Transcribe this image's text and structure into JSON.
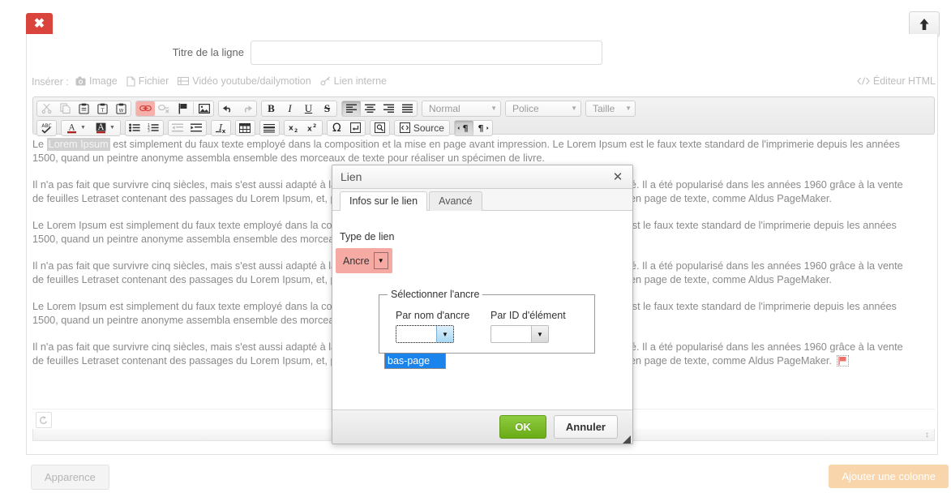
{
  "topbar": {
    "close_label": "✖",
    "scroll_top_icon": "arrow-up-icon"
  },
  "row_title": {
    "label": "Titre de la ligne",
    "value": "",
    "placeholder": ""
  },
  "insert_bar": {
    "label": "Insérer :",
    "items": [
      {
        "label": "Image",
        "icon": "camera-icon"
      },
      {
        "label": "Fichier",
        "icon": "file-icon"
      },
      {
        "label": "Vidéo youtube/dailymotion",
        "icon": "film-icon"
      },
      {
        "label": "Lien interne",
        "icon": "chain-icon"
      }
    ],
    "html_editor_label": "Éditeur HTML",
    "html_editor_icon": "code-icon"
  },
  "toolbar": {
    "row1": [
      {
        "name": "cut",
        "icon": "scissors-icon",
        "state": "dim"
      },
      {
        "name": "copy",
        "icon": "copy-icon",
        "state": "dim"
      },
      {
        "name": "paste",
        "icon": "paste-icon",
        "state": "normal"
      },
      {
        "name": "paste-text",
        "icon": "paste-text-icon",
        "state": "normal"
      },
      {
        "name": "paste-word",
        "icon": "paste-word-icon",
        "state": "normal"
      },
      {
        "name": "link",
        "icon": "link-icon",
        "state": "highlight"
      },
      {
        "name": "unlink",
        "icon": "unlink-icon",
        "state": "dim"
      },
      {
        "name": "anchor",
        "icon": "flag-icon",
        "state": "normal"
      },
      {
        "name": "image",
        "icon": "image-icon",
        "state": "normal"
      },
      {
        "name": "undo",
        "icon": "undo-arrow-icon",
        "state": "normal"
      },
      {
        "name": "redo",
        "icon": "redo-arrow-icon",
        "state": "dim"
      },
      {
        "name": "bold",
        "icon": "bold-icon",
        "state": "normal"
      },
      {
        "name": "italic",
        "icon": "italic-icon",
        "state": "normal"
      },
      {
        "name": "underline",
        "icon": "underline-icon",
        "state": "normal"
      },
      {
        "name": "strike",
        "icon": "strikethrough-icon",
        "state": "normal"
      },
      {
        "name": "align-left",
        "icon": "align-left-icon",
        "state": "active"
      },
      {
        "name": "align-center",
        "icon": "align-center-icon",
        "state": "normal"
      },
      {
        "name": "align-right",
        "icon": "align-right-icon",
        "state": "normal"
      },
      {
        "name": "align-justify",
        "icon": "align-justify-icon",
        "state": "normal"
      }
    ],
    "combos": [
      {
        "label": "Normal"
      },
      {
        "label": "Police"
      },
      {
        "label": "Taille"
      }
    ],
    "row2": [
      {
        "name": "spellcheck",
        "icon": "abc-check-icon",
        "state": "normal"
      },
      {
        "name": "text-color",
        "icon": "text-color-icon",
        "state": "normal"
      },
      {
        "name": "bg-color",
        "icon": "bg-color-icon",
        "state": "normal"
      },
      {
        "name": "bullet-list",
        "icon": "bullet-list-icon",
        "state": "normal"
      },
      {
        "name": "numbered-list",
        "icon": "numbered-list-icon",
        "state": "normal"
      },
      {
        "name": "outdent",
        "icon": "outdent-icon",
        "state": "dim"
      },
      {
        "name": "indent",
        "icon": "indent-icon",
        "state": "normal"
      },
      {
        "name": "remove-format",
        "icon": "remove-format-icon",
        "state": "normal"
      },
      {
        "name": "table",
        "icon": "table-icon",
        "state": "normal"
      },
      {
        "name": "horizontal-rule",
        "icon": "horizontal-rule-icon",
        "state": "normal"
      },
      {
        "name": "subscript",
        "icon": "subscript-icon",
        "state": "normal"
      },
      {
        "name": "superscript",
        "icon": "superscript-icon",
        "state": "normal"
      },
      {
        "name": "special-char",
        "icon": "omega-icon",
        "state": "normal"
      },
      {
        "name": "page-break",
        "icon": "page-break-icon",
        "state": "normal"
      },
      {
        "name": "preview",
        "icon": "preview-icon",
        "state": "normal"
      },
      {
        "name": "source",
        "icon": "source-code-icon",
        "state": "normal",
        "label": "Source"
      },
      {
        "name": "ltr",
        "icon": "text-direction-ltr-icon",
        "state": "active"
      },
      {
        "name": "rtl",
        "icon": "text-direction-rtl-icon",
        "state": "normal"
      }
    ]
  },
  "editor": {
    "selection_text": "Lorem Ipsum",
    "paragraphs": [
      {
        "lead": "Le ",
        "highlight": "Lorem Ipsum",
        "line1_rest": " est simplement du faux texte employé dans la composition et la mise en page avant impression. Le Lorem Ipsum est le faux texte standard de l'imprimerie depuis les années",
        "line2": "1500, quand un peintre anonyme assembla ensemble des morceaux de texte pour réaliser un spécimen de livre."
      },
      {
        "line1": "Il n'a pas fait que survivre cinq siècles, mais s'est aussi adapté à la bureautique informatique, sans que son contenu n'en soit modifié. Il a été popularisé dans les années 1960 grâce à la vente",
        "line2": "de feuilles Letraset contenant des passages du Lorem Ipsum, et, plus récemment, par son inclusion dans des applications de mise en page de texte, comme Aldus PageMaker."
      },
      {
        "line1": "Le Lorem Ipsum est simplement du faux texte employé dans la composition et la mise en page avant impression. Le Lorem Ipsum est le faux texte standard de l'imprimerie depuis les années",
        "line2": "1500, quand un peintre anonyme assembla ensemble des morceaux de texte pour réaliser un spécimen de livre."
      },
      {
        "line1": "Il n'a pas fait que survivre cinq siècles, mais s'est aussi adapté à la bureautique informatique, sans que son contenu n'en soit modifié. Il a été popularisé dans les années 1960 grâce à la vente",
        "line2": "de feuilles Letraset contenant des passages du Lorem Ipsum, et, plus récemment, par son inclusion dans des applications de mise en page de texte, comme Aldus PageMaker."
      },
      {
        "line1": "Le Lorem Ipsum est simplement du faux texte employé dans la composition et la mise en page avant impression. Le Lorem Ipsum est le faux texte standard de l'imprimerie depuis les années",
        "line2": "1500, quand un peintre anonyme assembla ensemble des morceaux de texte pour réaliser un spécimen de livre."
      },
      {
        "line1": "Il n'a pas fait que survivre cinq siècles, mais s'est aussi adapté à la bureautique informatique, sans que son contenu n'en soit modifié. Il a été popularisé dans les années 1960 grâce à la vente",
        "line2": "de feuilles Letraset contenant des passages du Lorem Ipsum, et, plus récemment, par son inclusion dans des applications de mise en page de texte, comme Aldus PageMaker.",
        "trailing_icon": "anchor-flag-icon"
      }
    ],
    "footer_icon": "undo-history-icon",
    "resize_icon": "resize-vertical-icon"
  },
  "dialog": {
    "title": "Lien",
    "close_icon": "close-icon",
    "tabs": [
      {
        "label": "Infos sur le lien",
        "active": true
      },
      {
        "label": "Avancé",
        "active": false
      }
    ],
    "link_type_label": "Type de lien",
    "link_type_value": "Ancre",
    "fieldset_legend": "Sélectionner l'ancre",
    "by_name_label": "Par nom d'ancre",
    "by_name_value": "",
    "by_id_label": "Par ID d'élément",
    "by_id_value": "",
    "dropdown_options": [
      "bas-page"
    ],
    "ok_label": "OK",
    "cancel_label": "Annuler"
  },
  "bottom": {
    "apparence_label": "Apparence",
    "add_column_label": "Ajouter une colonne"
  },
  "colors": {
    "close_tab_red": "#d9453c",
    "highlight_pink": "#f6aaa4",
    "ok_green": "#7cbd2b",
    "add_column_orange": "#f8d5ab",
    "option_blue": "#1a84ec",
    "text_grey": "#8a8a8a"
  }
}
